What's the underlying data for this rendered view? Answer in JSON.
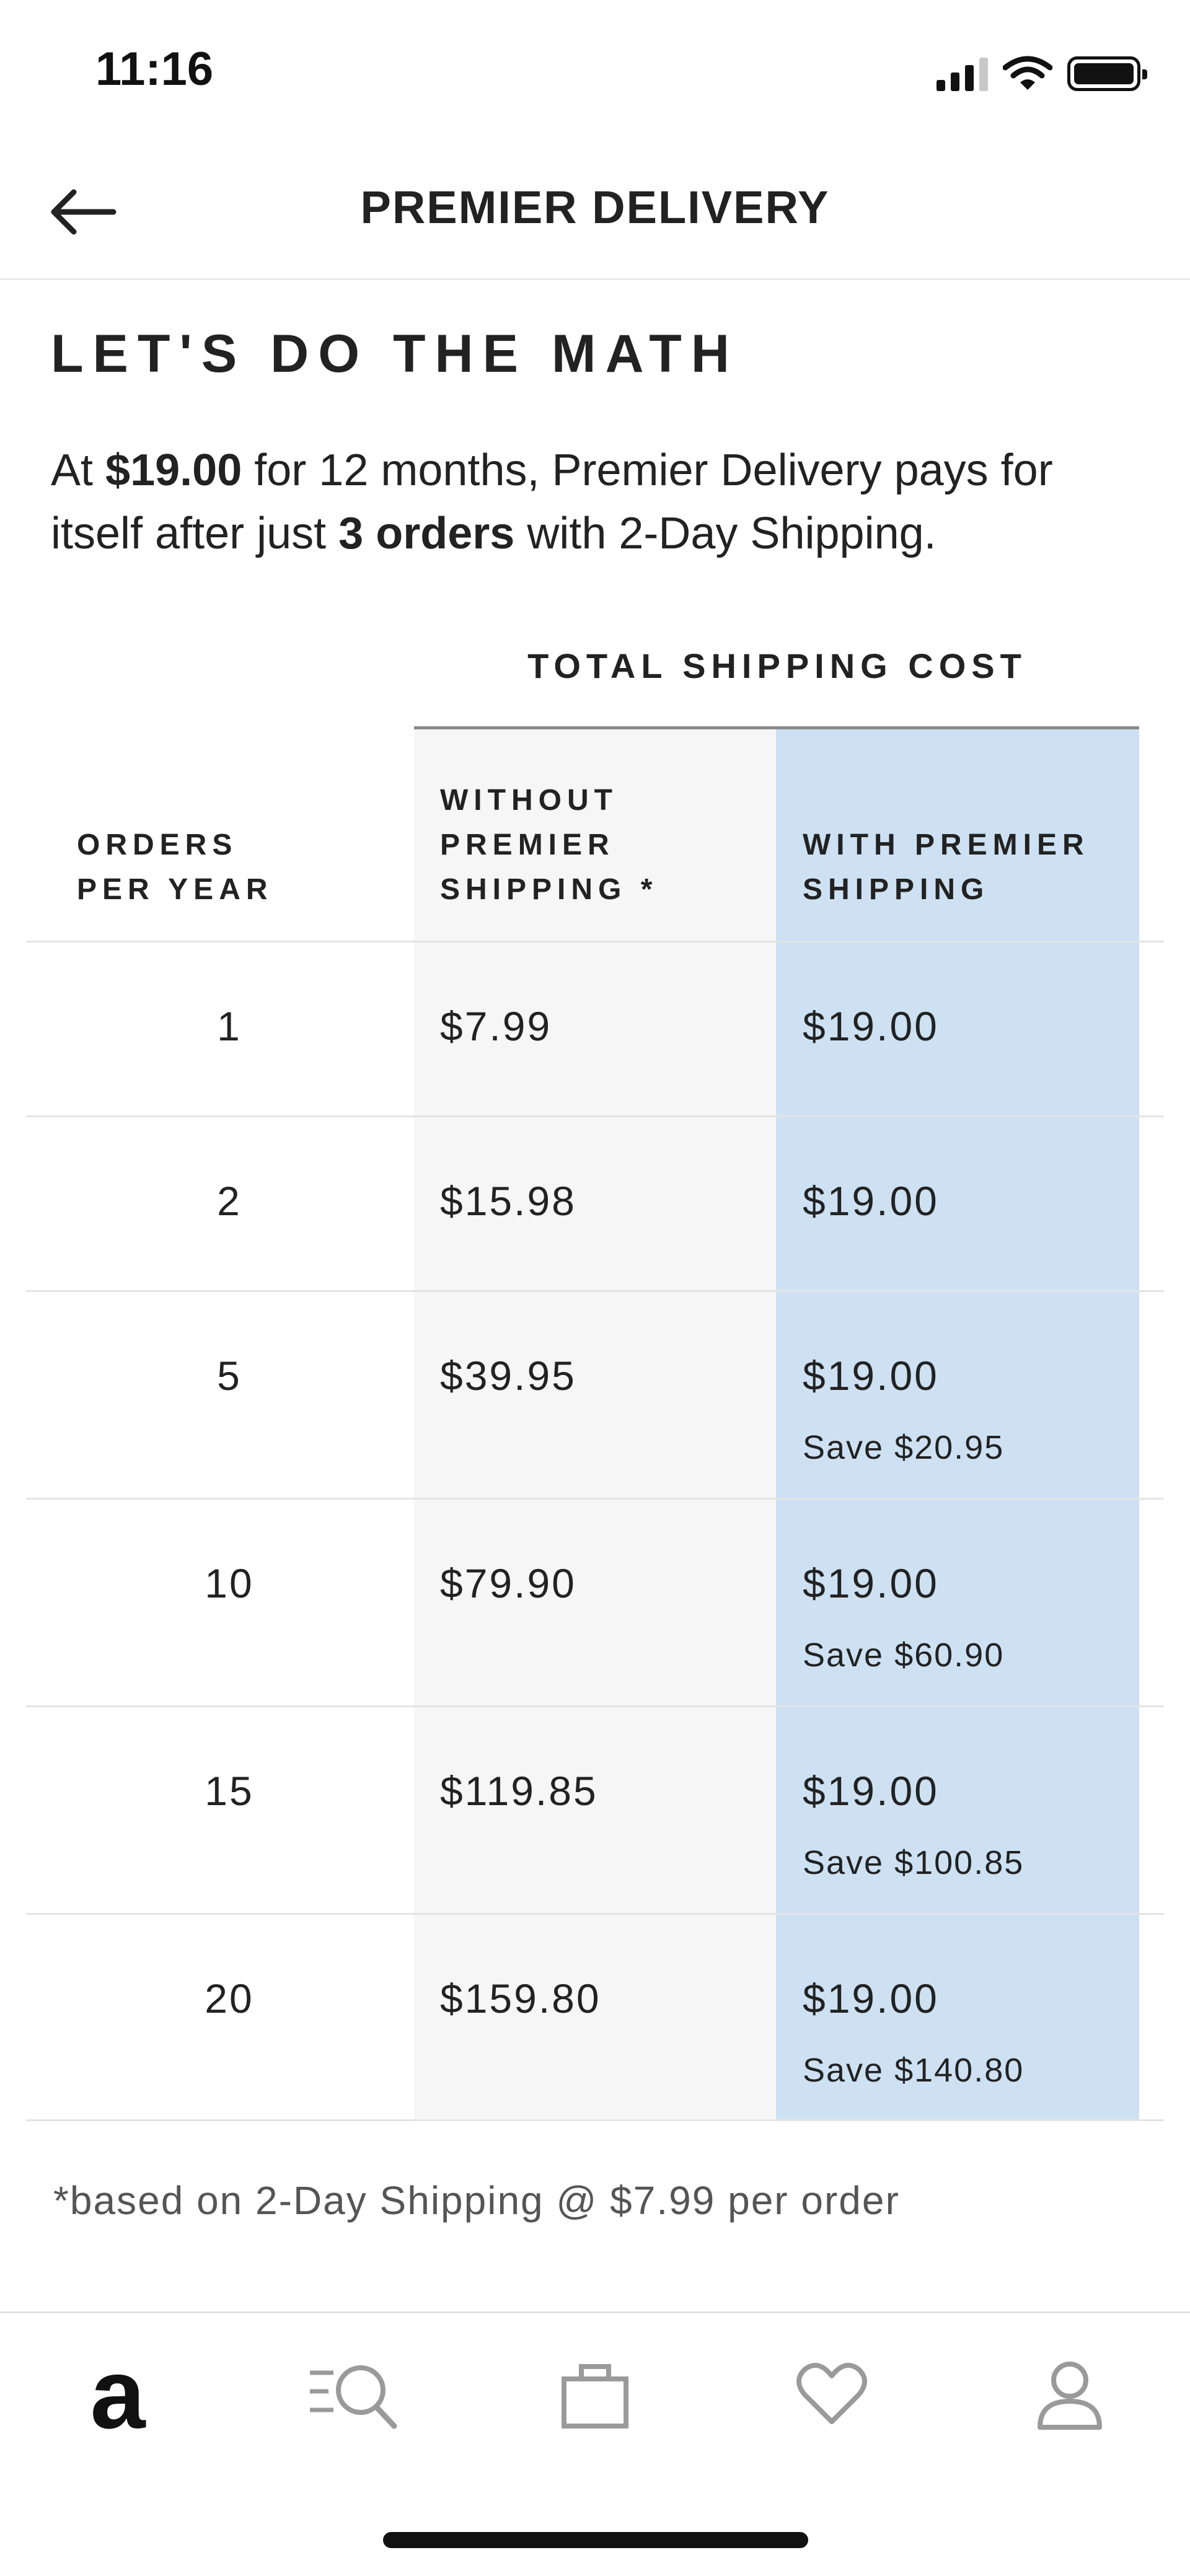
{
  "status_bar": {
    "time": "11:16"
  },
  "header": {
    "title": "PREMIER DELIVERY"
  },
  "math": {
    "heading": "LET'S DO THE MATH",
    "intro_part1": "At ",
    "intro_price": "$19.00",
    "intro_part2": " for 12 months, Premier Delivery pays for itself after just ",
    "intro_orders": "3 orders",
    "intro_part3": " with 2-Day Shipping."
  },
  "table": {
    "group_header": "TOTAL SHIPPING COST",
    "col_orders": [
      "ORDERS",
      "PER YEAR"
    ],
    "col_without": [
      "WITHOUT",
      "PREMIER",
      "SHIPPING *"
    ],
    "col_with": [
      "WITH PREMIER",
      "SHIPPING"
    ],
    "rows": [
      {
        "orders": "1",
        "without": "$7.99",
        "with": "$19.00",
        "save": ""
      },
      {
        "orders": "2",
        "without": "$15.98",
        "with": "$19.00",
        "save": ""
      },
      {
        "orders": "5",
        "without": "$39.95",
        "with": "$19.00",
        "save": "Save $20.95"
      },
      {
        "orders": "10",
        "without": "$79.90",
        "with": "$19.00",
        "save": "Save $60.90"
      },
      {
        "orders": "15",
        "without": "$119.85",
        "with": "$19.00",
        "save": "Save $100.85"
      },
      {
        "orders": "20",
        "without": "$159.80",
        "with": "$19.00",
        "save": "Save $140.80"
      }
    ]
  },
  "footnote": "*based on 2-Day Shipping @ $7.99 per order",
  "tab_bar": {
    "tabs": [
      {
        "name": "home",
        "icon": "logo-a-icon"
      },
      {
        "name": "search",
        "icon": "search-icon"
      },
      {
        "name": "bag",
        "icon": "bag-icon"
      },
      {
        "name": "wishlist",
        "icon": "heart-icon"
      },
      {
        "name": "account",
        "icon": "user-icon"
      }
    ],
    "home_glyph": "a"
  },
  "colors": {
    "highlight_column": "#cde1f3",
    "shaded_column": "#f6f6f6",
    "text": "#222222"
  }
}
